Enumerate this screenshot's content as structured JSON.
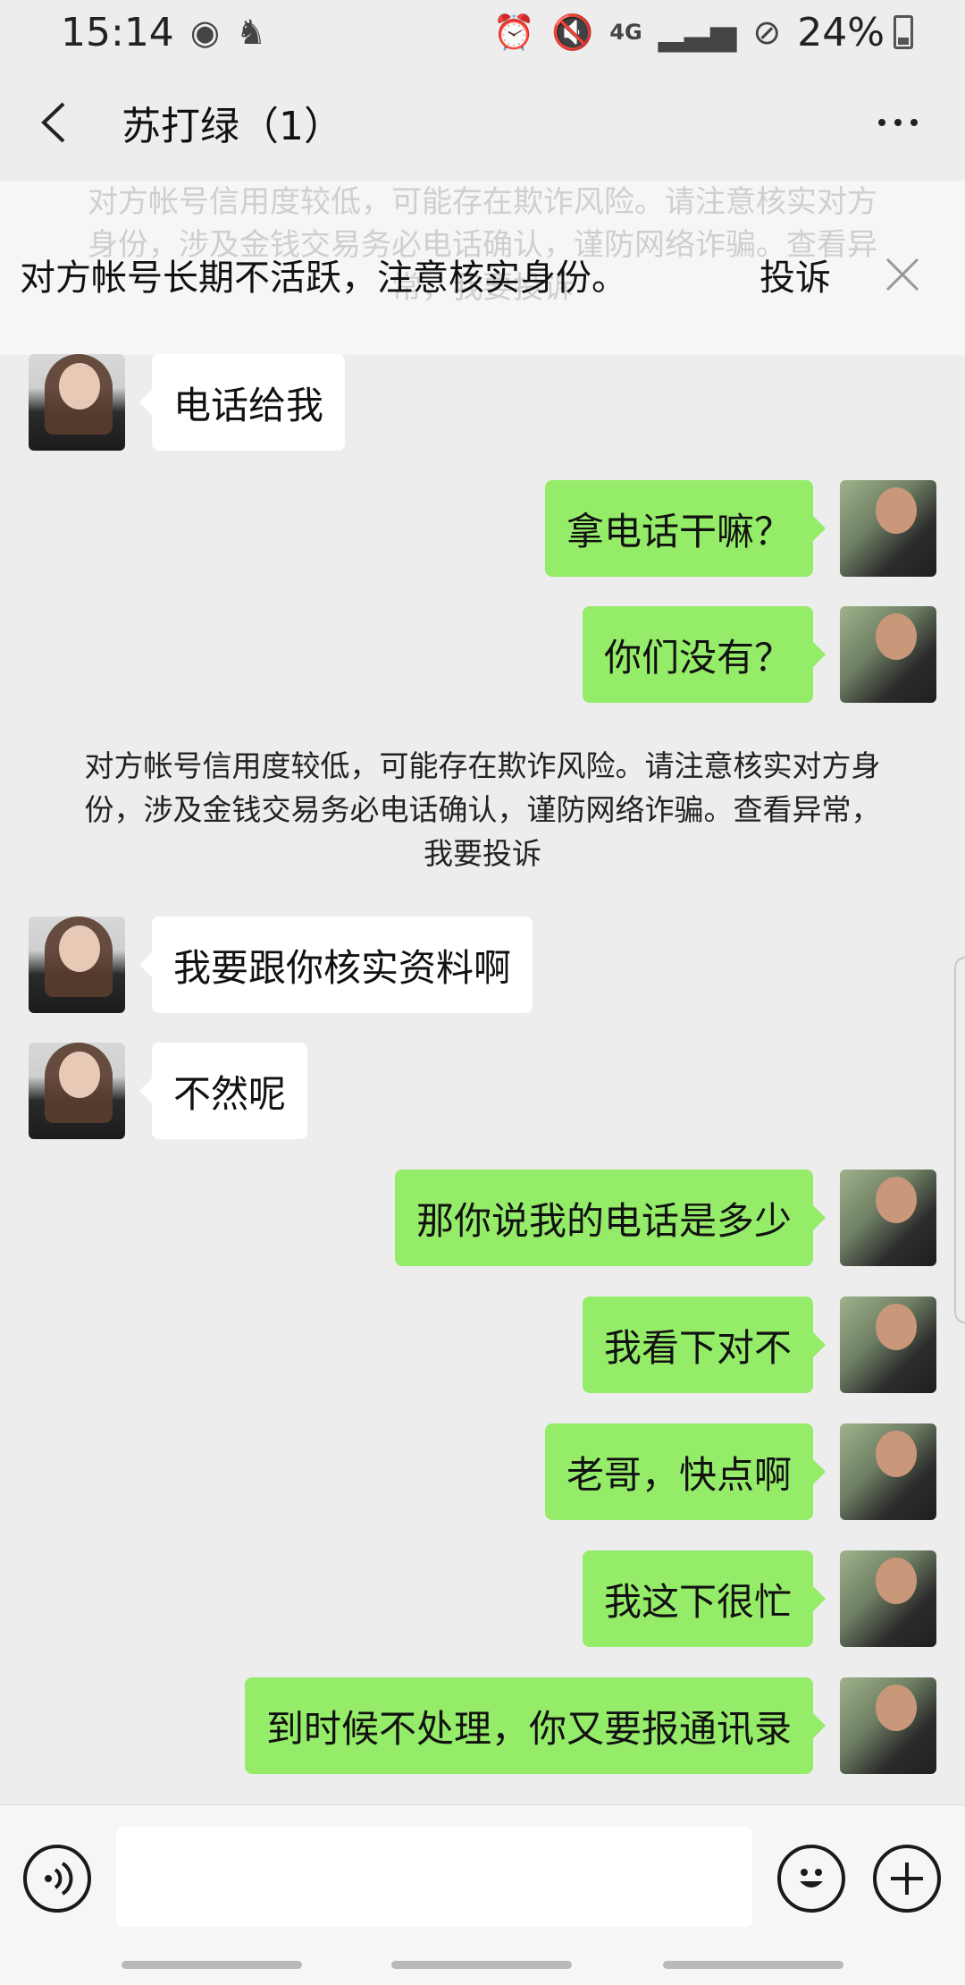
{
  "status_bar": {
    "time": "15:14",
    "battery": "24%",
    "signal_label": "4G"
  },
  "header": {
    "title": "苏打绿（1）"
  },
  "warning_banner": {
    "text": "对方帐号长期不活跃，注意核实身份。",
    "report_label": "投诉",
    "background_text": "对方帐号信用度较低，可能存在欺诈风险。请注意核实对方身份，涉及金钱交易务必电话确认，谨防网络诈骗。查看异常，我要投诉"
  },
  "messages": [
    {
      "side": "in",
      "text": "电话给我"
    },
    {
      "side": "out",
      "text": "拿电话干嘛？"
    },
    {
      "side": "out",
      "text": "你们没有？"
    },
    {
      "side": "in",
      "text": "我要跟你核实资料啊"
    },
    {
      "side": "in",
      "text": "不然呢"
    },
    {
      "side": "out",
      "text": "那你说我的电话是多少"
    },
    {
      "side": "out",
      "text": "我看下对不"
    },
    {
      "side": "out",
      "text": "老哥，快点啊"
    },
    {
      "side": "out",
      "text": "我这下很忙"
    },
    {
      "side": "out",
      "text": "到时候不处理，你又要报通讯录"
    }
  ],
  "system_note": "对方帐号信用度较低，可能存在欺诈风险。请注意核实对方身份，涉及金钱交易务必电话确认，谨防网络诈骗。查看异常，我要投诉",
  "input": {
    "value": ""
  },
  "colors": {
    "outgoing_bubble": "#95ec69",
    "incoming_bubble": "#ffffff",
    "background": "#ededed"
  }
}
